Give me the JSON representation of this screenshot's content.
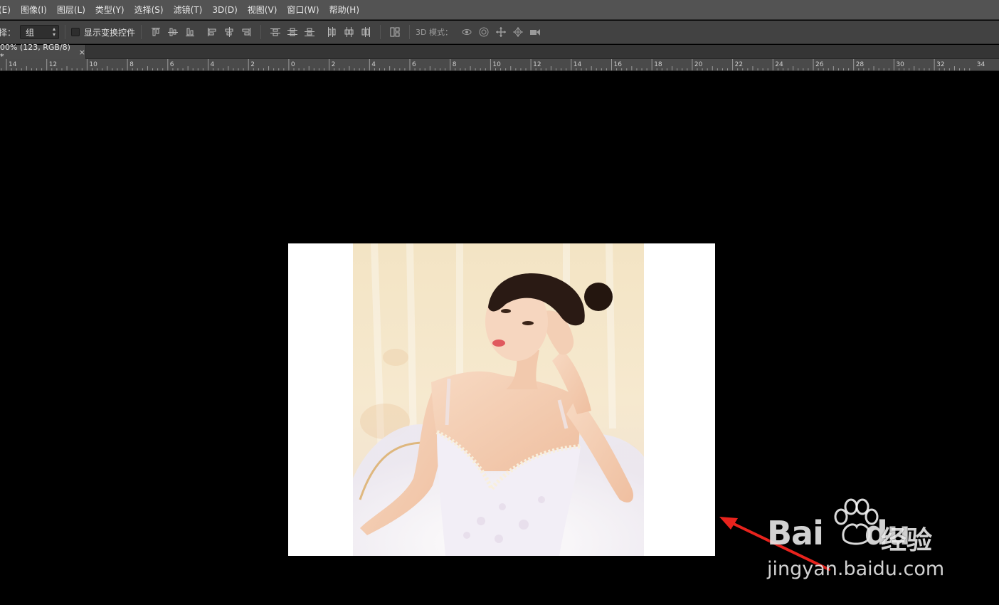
{
  "menu": {
    "items": [
      "(E)",
      "图像(I)",
      "图层(L)",
      "类型(Y)",
      "选择(S)",
      "滤镜(T)",
      "3D(D)",
      "视图(V)",
      "窗口(W)",
      "帮助(H)"
    ]
  },
  "options": {
    "select_label": "择：",
    "select_value": "组",
    "show_transform_label": "显示变换控件",
    "mode_label": "3D 模式："
  },
  "tab": {
    "title": "00% (123, RGB/8) *",
    "close": "×"
  },
  "ruler": {
    "labels": [
      "14",
      "12",
      "10",
      "8",
      "6",
      "4",
      "2",
      "0",
      "2",
      "4",
      "6",
      "8",
      "10",
      "12",
      "14",
      "16",
      "18",
      "20",
      "22",
      "24",
      "26",
      "28",
      "30",
      "32",
      "34"
    ]
  },
  "watermark": {
    "brand": "Bai",
    "brand2": "du",
    "product": "经验",
    "url": "jingyan.baidu.com"
  },
  "colors": {
    "annotation_arrow": "#e8231d",
    "canvas_bg": "#000000",
    "document_bg": "#ffffff"
  }
}
